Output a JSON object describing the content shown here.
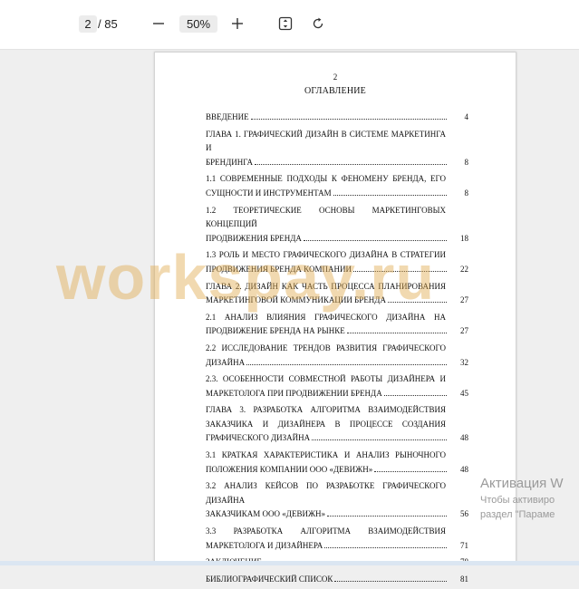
{
  "toolbar": {
    "current_page": "2",
    "total_pages": "/ 85",
    "zoom": "50%",
    "icons": {
      "zoom_out": "minus-icon",
      "zoom_in": "plus-icon",
      "fit": "fit-page-icon",
      "rotate": "rotate-icon"
    }
  },
  "document": {
    "page_number": "2",
    "title": "ОГЛАВЛЕНИЕ",
    "entries": [
      {
        "lines": [
          "ВВЕДЕНИЕ"
        ],
        "page": "4"
      },
      {
        "lines": [
          "ГЛАВА 1. ГРАФИЧЕСКИЙ ДИЗАЙН В СИСТЕМЕ МАРКЕТИНГА И",
          "БРЕНДИНГА"
        ],
        "page": "8"
      },
      {
        "lines": [
          "1.1 СОВРЕМЕННЫЕ ПОДХОДЫ К ФЕНОМЕНУ БРЕНДА, ЕГО",
          "СУЩНОСТИ И ИНСТРУМЕНТАМ"
        ],
        "page": "8"
      },
      {
        "lines": [
          "1.2 ТЕОРЕТИЧЕСКИЕ ОСНОВЫ МАРКЕТИНГОВЫХ КОНЦЕПЦИЙ",
          "ПРОДВИЖЕНИЯ БРЕНДА"
        ],
        "page": "18"
      },
      {
        "lines": [
          "1.3 РОЛЬ И МЕСТО ГРАФИЧЕСКОГО ДИЗАЙНА В СТРАТЕГИИ",
          "ПРОДВИЖЕНИЯ БРЕНДА КОМПАНИИ"
        ],
        "page": "22"
      },
      {
        "lines": [
          "ГЛАВА 2. ДИЗАЙН КАК ЧАСТЬ ПРОЦЕССА ПЛАНИРОВАНИЯ",
          "МАРКЕТИНГОВОЙ КОММУНИКАЦИИ БРЕНДА"
        ],
        "page": "27"
      },
      {
        "lines": [
          "2.1 АНАЛИЗ ВЛИЯНИЯ ГРАФИЧЕСКОГО ДИЗАЙНА НА",
          "ПРОДВИЖЕНИЕ БРЕНДА НА РЫНКЕ"
        ],
        "page": "27"
      },
      {
        "lines": [
          "2.2 ИССЛЕДОВАНИЕ ТРЕНДОВ РАЗВИТИЯ ГРАФИЧЕСКОГО",
          "ДИЗАЙНА"
        ],
        "page": "32"
      },
      {
        "lines": [
          "2.3. ОСОБЕННОСТИ СОВМЕСТНОЙ РАБОТЫ ДИЗАЙНЕРА И",
          "МАРКЕТОЛОГА ПРИ ПРОДВИЖЕНИИ БРЕНДА"
        ],
        "page": "45"
      },
      {
        "lines": [
          "ГЛАВА 3. РАЗРАБОТКА АЛГОРИТМА ВЗАИМОДЕЙСТВИЯ",
          "ЗАКАЗЧИКА И ДИЗАЙНЕРА В ПРОЦЕССЕ СОЗДАНИЯ",
          "ГРАФИЧЕСКОГО ДИЗАЙНА"
        ],
        "page": "48"
      },
      {
        "lines": [
          "3.1 КРАТКАЯ ХАРАКТЕРИСТИКА И АНАЛИЗ РЫНОЧНОГО",
          "ПОЛОЖЕНИЯ КОМПАНИИ ООО «ДЕВИЖН»"
        ],
        "page": "48"
      },
      {
        "lines": [
          "3.2 АНАЛИЗ КЕЙСОВ ПО РАЗРАБОТКЕ ГРАФИЧЕСКОГО ДИЗАЙНА",
          "ЗАКАЗЧИКАМ ООО «ДЕВИЖН»"
        ],
        "page": "56"
      },
      {
        "lines": [
          "3.3 РАЗРАБОТКА АЛГОРИТМА ВЗАИМОДЕЙСТВИЯ",
          "МАРКЕТОЛОГА И ДИЗАЙНЕРА"
        ],
        "page": "71"
      },
      {
        "lines": [
          "ЗАКЛЮЧЕНИЕ"
        ],
        "page": "78"
      },
      {
        "lines": [
          "БИБЛИОГРАФИЧЕСКИЙ СПИСОК"
        ],
        "page": "81"
      }
    ]
  },
  "watermark": "workspay.ru",
  "activation": {
    "title": "Активация W",
    "line1": "Чтобы активиро",
    "line2": "раздел \"Параме"
  }
}
